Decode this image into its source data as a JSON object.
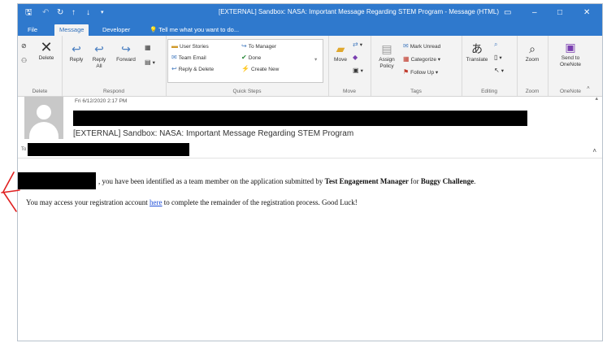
{
  "window": {
    "title": "[EXTERNAL] Sandbox: NASA: Important Message Regarding STEM Program - Message (HTML)",
    "quick_access": [
      "save-icon",
      "undo-icon",
      "redo-icon",
      "up-arrow-icon",
      "down-arrow-icon",
      "customize-icon"
    ]
  },
  "tabs": [
    {
      "label": "File"
    },
    {
      "label": "Message"
    },
    {
      "label": "Developer"
    }
  ],
  "tell_me": "Tell me what you want to do...",
  "ribbon": {
    "delete_group": {
      "label": "Delete",
      "delete_button": "Delete"
    },
    "respond_group": {
      "label": "Respond",
      "reply": "Reply",
      "reply_all": "Reply All",
      "forward": "Forward"
    },
    "quick_steps": {
      "label": "Quick Steps",
      "items": [
        "User Stories",
        "Team Email",
        "Reply & Delete",
        "To Manager",
        "Done",
        "Create New"
      ]
    },
    "move_group": {
      "label": "Move",
      "move_button": "Move"
    },
    "tags_group": {
      "label": "Tags",
      "assign_policy": "Assign Policy",
      "mark_unread": "Mark Unread",
      "categorize": "Categorize",
      "follow_up": "Follow Up"
    },
    "editing_group": {
      "label": "Editing",
      "translate": "Translate"
    },
    "zoom_group": {
      "label": "Zoom",
      "zoom_button": "Zoom"
    },
    "onenote_group": {
      "label": "OneNote",
      "send_button": "Send to OneNote"
    }
  },
  "message": {
    "date": "Fri 6/12/2020 2:17 PM",
    "subject": "[EXTERNAL] Sandbox: NASA: Important Message Regarding STEM Program",
    "to_label": "To",
    "line1_part1": ", you have been identified as a team member on the application submitted by",
    "line1_bold1": "Test Engagement Manager",
    "line1_part2": "for",
    "line1_bold2": "Buggy Challenge",
    "line1_end": ".",
    "line2_part1": "You may access your registration account",
    "line2_link": "here",
    "line2_part2": "to complete the remainder of the registration process. Good Luck!"
  },
  "colors": {
    "title_bar": "#2f79cd",
    "link": "#1f4fd8",
    "annotation": "#e02020"
  }
}
